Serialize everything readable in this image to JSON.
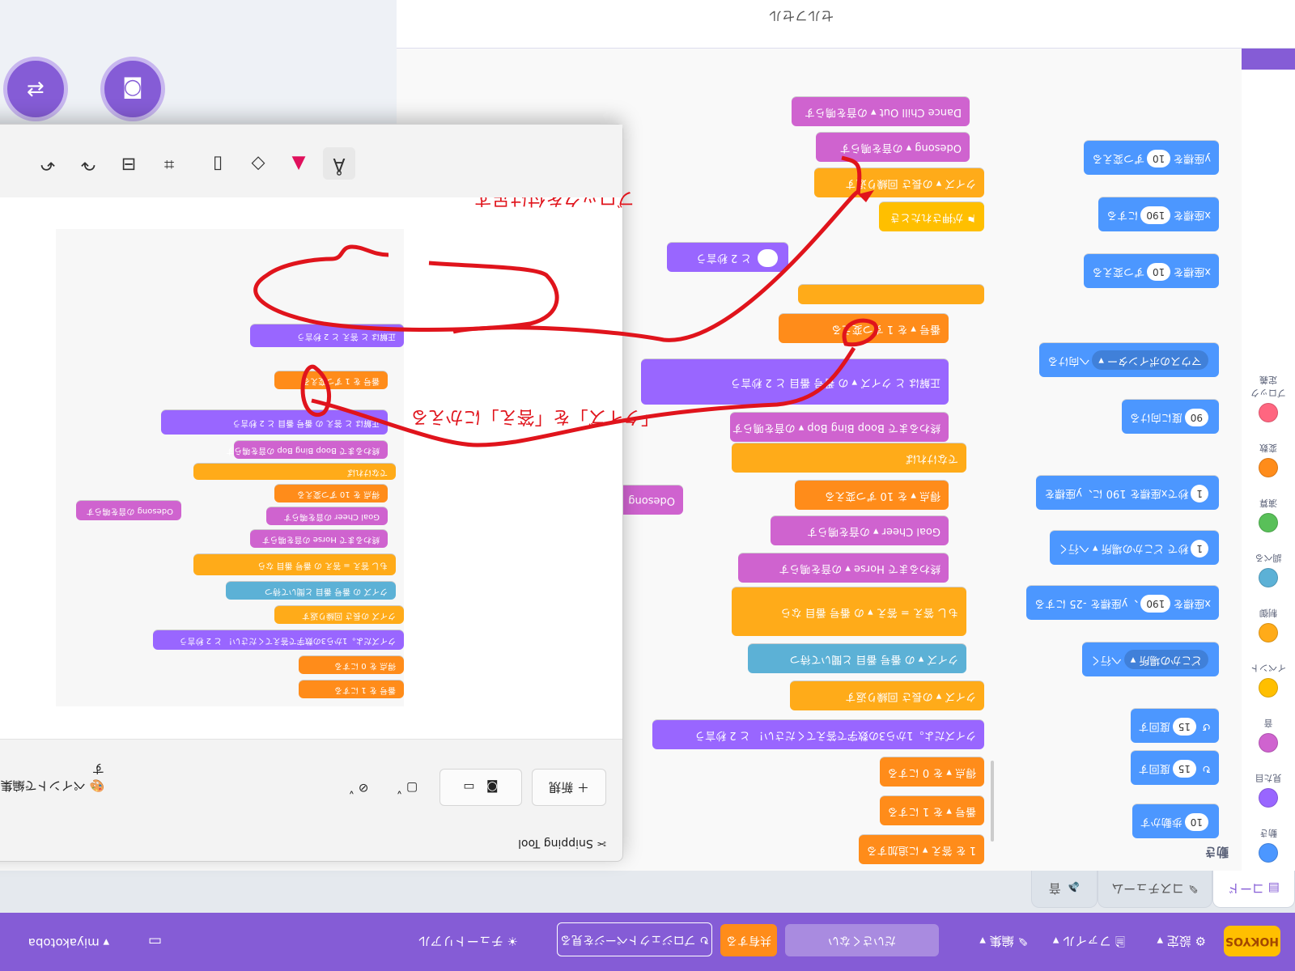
{
  "menubar": {
    "logo": "HOKYOS",
    "settings": "設定",
    "file": "ファイル",
    "edit": "編集",
    "project_title": "だいさくない",
    "share": "共有する",
    "project_page": "プロジェクトページを見る",
    "tutorials": "チュートリアル",
    "username": "miyakotoba"
  },
  "tabs": {
    "code": "コード",
    "costumes": "コスチューム",
    "sounds": "音"
  },
  "categories": [
    {
      "label": "動き",
      "color": "#4c97ff"
    },
    {
      "label": "見た目",
      "color": "#9966ff"
    },
    {
      "label": "音",
      "color": "#cf63cf"
    },
    {
      "label": "イベント",
      "color": "#ffbf00"
    },
    {
      "label": "制御",
      "color": "#ffab19"
    },
    {
      "label": "調べる",
      "color": "#5cb1d6"
    },
    {
      "label": "演算",
      "color": "#59c059"
    },
    {
      "label": "変数",
      "color": "#ff8c1a"
    },
    {
      "label": "ブロック定義",
      "color": "#ff6680"
    }
  ],
  "palette": {
    "title": "動き",
    "blocks": [
      {
        "pre": "",
        "num": "10",
        "post": "歩動かす"
      },
      {
        "pre": "",
        "num": "15",
        "post": "度回す"
      },
      {
        "pre": "",
        "num": "15",
        "post": "度回す"
      },
      {
        "pre": "",
        "drop": "どこかの場所 ▾",
        "post": "へ行く"
      },
      {
        "pre": "x座標を",
        "num": "190",
        "post": "、y座標を -25 にする"
      },
      {
        "pre": "",
        "num": "1",
        "post": "秒で どこかの場所 ▾ へ行く"
      },
      {
        "pre": "",
        "num": "1",
        "post": "秒でx座標を 190 に、y座標を"
      },
      {
        "pre": "",
        "num": "90",
        "post": "度に向ける"
      },
      {
        "pre": "",
        "drop": "マウスのポインター ▾",
        "post": "へ向ける"
      },
      {
        "pre": "x座標を",
        "num": "10",
        "post": "ずつ変える"
      },
      {
        "pre": "x座標を",
        "num": "190",
        "post": "にする"
      },
      {
        "pre": "y座標を",
        "num": "10",
        "post": "ずつ変える"
      }
    ]
  },
  "script": {
    "hat": "が押されたとき",
    "b1": "Odesong ▾ の音を鳴らす",
    "b2": "Dance Chill Out ▾ の音を鳴らす",
    "b3": "クイズ ▾ の長さ 回繰り返す",
    "forever_top": "",
    "change_num": "番号 ▾ を 1 ずつ変える",
    "say": "正解は と クイズ ▾ の 番号 番目 と 2 秒言う",
    "play_boop": "終わるまで Boop Bing Bop ▾ の音を鳴らす",
    "else": "でなければ",
    "change_score": "得点 ▾ を 10 ずつ変える",
    "goal": "Goal Cheer ▾ の音を鳴らす",
    "horse": "終わるまで Horse ▾ の音を鳴らす",
    "if": "もし 答え = 答え ▾ の 番号 番目 なら",
    "ask": "クイズ ▾ の 番号 番目 と聞いて待つ",
    "repeat": "クイズ ▾ の長さ 回繰り返す",
    "say2": "クイズだよ。1から3の数字で答えてください！ と 2 秒言う",
    "set_score": "得点 ▾ を 0 にする",
    "set_num": "番号 ▾ を 1 にする",
    "add_list": "1 を 答え ▾ に追加する",
    "say_loose": "と 2 秒言う",
    "odesong_loose": "Odesong"
  },
  "snipping": {
    "app_name": "Snipping Tool",
    "new_button": "新規",
    "paint_edit": "ペイントで編集します",
    "annotation_top": "ブロックを付け足す",
    "annotation_bottom": "「クイズ」を「答え」にかえる"
  },
  "mini_script": {
    "say_top": "正解は と 答え と 2 秒言う",
    "b_change1": "番号 を 1 ずつ変える",
    "b_say": "正解は と 答え の 番号 番目 と 2 秒言う",
    "b_play": "終わるまで Boop Bing Bop の音を鳴らす",
    "b_else": "でなければ",
    "b_change_score": "得点 を 10 ずつ変える",
    "b_goal": "Goal Cheer の音を鳴らす",
    "b_horse": "終わるまで Horse の音を鳴らす",
    "b_if": "もし 答え = 答え の 番号 番目 なら",
    "b_ask": "クイズ の 番号 番目 と聞いて待つ",
    "b_repeat": "クイズ の長さ 回繰り返す",
    "b_say2": "クイズだよ。1から3の数字で答えてください！ と 2 秒言う",
    "b_set_score": "得点 を 0 にする",
    "b_set_num": "番号 を 1 にする",
    "b_odesong": "Odesong の音を鳴らす"
  },
  "stage": {
    "url": "セルフセル"
  }
}
